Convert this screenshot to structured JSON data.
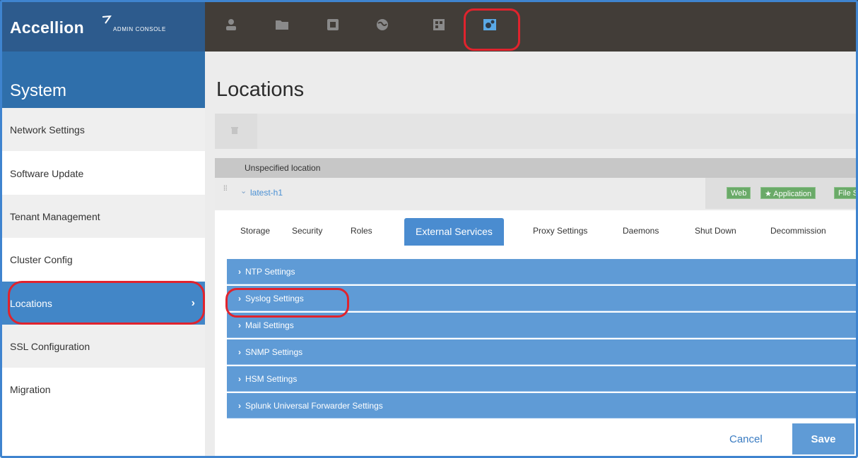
{
  "header": {
    "logo_text": "Accellion",
    "logo_subtitle": "ADMIN CONSOLE",
    "nav_icons": [
      "user-icon",
      "folder-icon",
      "tablet-icon",
      "globe-icon",
      "grid-icon",
      "system-icon"
    ],
    "active_nav": "system-icon"
  },
  "sidebar": {
    "title": "System",
    "items": [
      {
        "label": "Network Settings"
      },
      {
        "label": "Software Update"
      },
      {
        "label": "Tenant Management"
      },
      {
        "label": "Cluster Config"
      },
      {
        "label": "Locations"
      },
      {
        "label": "SSL Configuration"
      },
      {
        "label": "Migration"
      }
    ],
    "active_item": "Locations"
  },
  "main": {
    "page_title": "Locations",
    "location": {
      "header": "Unspecified location",
      "name": "latest-h1",
      "badges": [
        "Web",
        "★ Application",
        "File S"
      ]
    },
    "tabs": [
      "Storage",
      "Security",
      "Roles",
      "External Services",
      "Proxy Settings",
      "Daemons",
      "Shut Down",
      "Decommission"
    ],
    "active_tab": "External Services",
    "sections": [
      "NTP Settings",
      "Syslog Settings",
      "Mail Settings",
      "SNMP Settings",
      "HSM Settings",
      "Splunk Universal Forwarder Settings"
    ],
    "cancel_label": "Cancel",
    "save_label": "Save"
  },
  "colors": {
    "topbar": "#423d38",
    "sidebar_title": "#2f6fab",
    "accent_blue": "#4a8cd0",
    "highlight_red": "#e0232d",
    "badge_green": "#6aaa68"
  }
}
